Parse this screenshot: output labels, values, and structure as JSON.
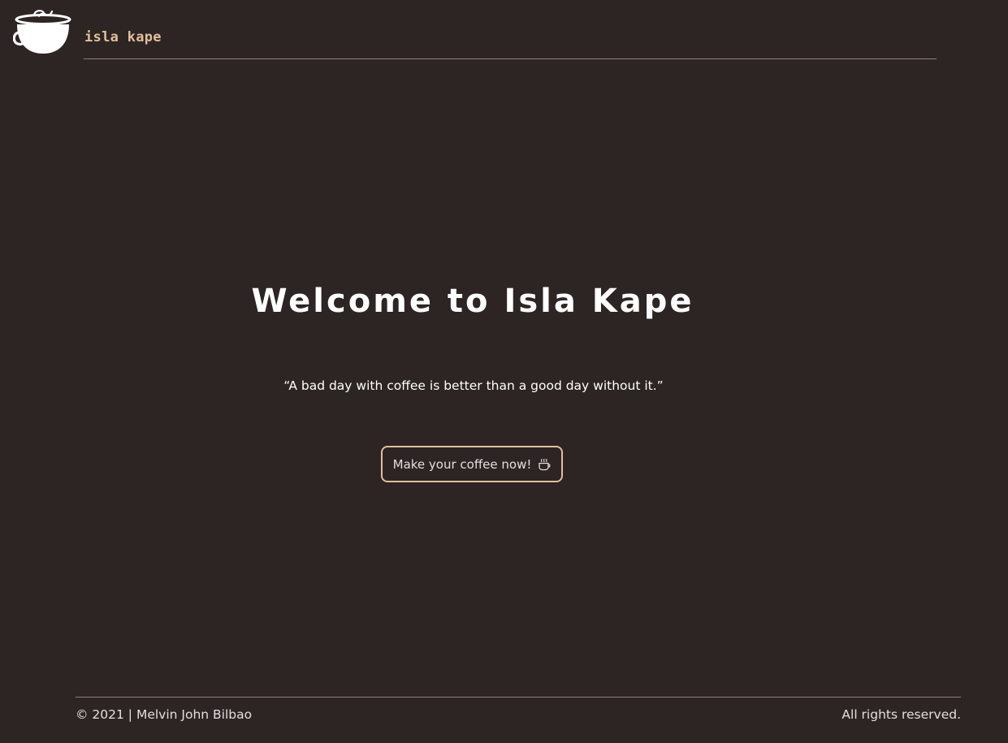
{
  "header": {
    "brand": "isla kape",
    "logo_icon": "coffee-cup-icon"
  },
  "hero": {
    "title": "Welcome to Isla Kape",
    "quote": "“A bad day with coffee is better than a good day without it.”",
    "cta_label": "Make your coffee now!",
    "cta_icon": "coffee-mug-icon"
  },
  "footer": {
    "copyright": "© 2021 | Melvin John Bilbao",
    "rights": "All rights reserved."
  },
  "colors": {
    "background": "#2d2424",
    "accent": "#e0c097",
    "text": "#ffffff",
    "muted_text": "#e6dede",
    "divider": "#8a8180"
  }
}
